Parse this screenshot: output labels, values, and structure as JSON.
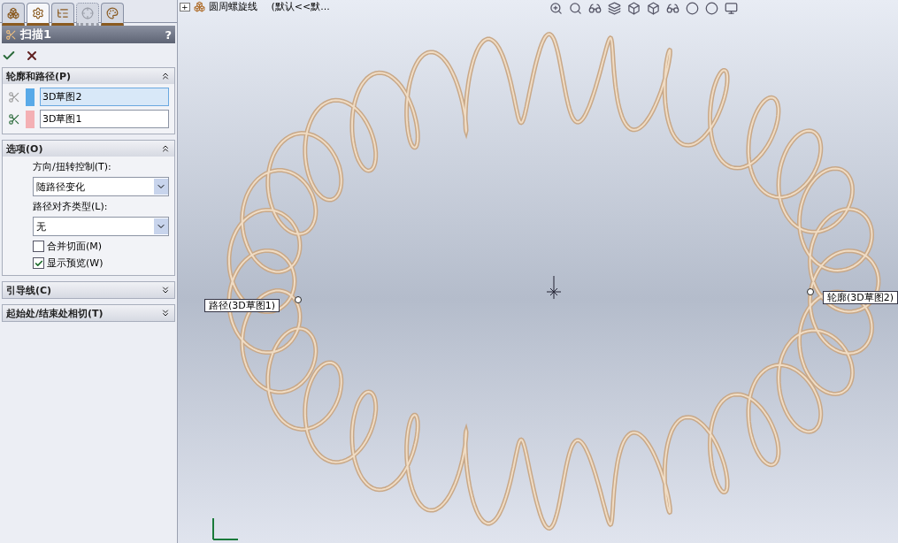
{
  "panel_tabs": [
    {
      "selected": false,
      "disabled": false
    },
    {
      "selected": true,
      "disabled": false
    },
    {
      "selected": false,
      "disabled": false
    },
    {
      "selected": false,
      "disabled": true
    },
    {
      "selected": false,
      "disabled": false
    }
  ],
  "feature": {
    "title": "扫描1",
    "help": "?"
  },
  "sections": [
    {
      "kind": "selections",
      "title": "轮廓和路径(P)",
      "expanded": true,
      "items": [
        {
          "value": "3D草图2",
          "selected": true,
          "color": "#5aaae8"
        },
        {
          "value": "3D草图1",
          "selected": false,
          "color": "#f4b0b4"
        }
      ]
    },
    {
      "kind": "options",
      "title": "选项(O)",
      "expanded": true,
      "items": [
        {
          "kind": "select",
          "label": "方向/扭转控制(T):",
          "value": "随路径变化"
        },
        {
          "kind": "select",
          "label": "路径对齐类型(L):",
          "value": "无"
        },
        {
          "kind": "checkbox",
          "label": "合并切面(M)",
          "checked": false
        },
        {
          "kind": "checkbox",
          "label": "显示预览(W)",
          "checked": true
        }
      ]
    },
    {
      "kind": "empty",
      "title": "引导线(C)",
      "expanded": false
    },
    {
      "kind": "empty",
      "title": "起始处/结束处相切(T)",
      "expanded": false
    }
  ],
  "tree": {
    "expander": "+",
    "name": "圆周螺旋线",
    "config": "(默认<<默..."
  },
  "callouts": [
    {
      "text": "路径(3D草图1)"
    },
    {
      "text": "轮廓(3D草图2)"
    }
  ]
}
